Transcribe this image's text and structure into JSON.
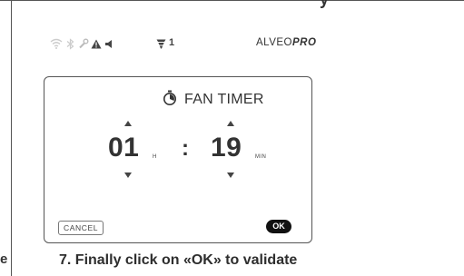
{
  "page": {
    "cut_heading": "y",
    "cut_left_char": "e",
    "caption": "7. Finally click on «OK» to  validate"
  },
  "statusbar": {
    "icons": [
      "wifi-icon",
      "bluetooth-icon",
      "wrench-icon",
      "warning-icon",
      "speaker-icon",
      "filter-icon"
    ],
    "filter_count": "1",
    "brand_regular": "ALVEO",
    "brand_bold": "PRO"
  },
  "dialog": {
    "icon": "timer-icon",
    "title": "FAN TIMER",
    "hours": "01",
    "hours_unit": "H",
    "separator": ":",
    "minutes": "19",
    "minutes_unit": "MIN",
    "cancel_label": "CANCEL",
    "ok_label": "OK"
  },
  "colors": {
    "text": "#333333",
    "ok_button_bg": "#111111",
    "status_icons_light": "#cccccc",
    "status_icons_dark": "#444444"
  }
}
